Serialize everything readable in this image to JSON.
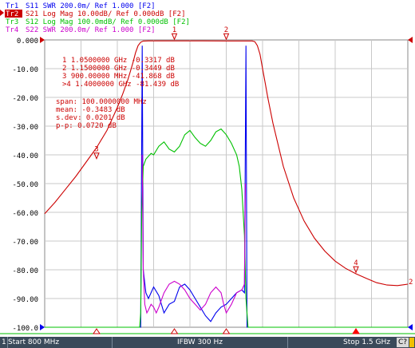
{
  "header_lines": [
    {
      "id": "Tr1",
      "trace": "Tr1",
      "text": "S11  SWR 200.0m/ Ref 1.000 [F2]",
      "color": "#0000ee",
      "active": false
    },
    {
      "id": "Tr2",
      "trace": "Tr2",
      "text": "S21  Log Mag 10.00dB/ Ref 0.000dB [F2]",
      "color": "#cc0000",
      "active": true
    },
    {
      "id": "Tr3",
      "trace": "Tr3",
      "text": "S12  Log Mag 100.0mdB/ Ref 0.000dB [F2]",
      "color": "#00c000",
      "active": false
    },
    {
      "id": "Tr4",
      "trace": "Tr4",
      "text": "S22  SWR 200.0m/ Ref 1.000 [F2]",
      "color": "#cc00cc",
      "active": false
    }
  ],
  "marker_table": [
    "  1   1.0500000 GHz  -0.3317 dB",
    "  2   1.1500000 GHz  -0.3449 dB",
    "  3   900.00000 MHz  -41.868 dB",
    " >4   1.4000000 GHz  -81.439 dB"
  ],
  "stats": [
    "    span:  100.0000000 MHz",
    "    mean:  -0.3483 dB",
    "  s.dev:   0.0201 dB",
    "    p-p:   0.0720 dB"
  ],
  "status": {
    "channel_number": "1",
    "start": "Start 800 MHz",
    "ifbw": "IFBW 300 Hz",
    "stop": "Stop 1.5 GHz",
    "channel": "C?"
  },
  "colors": {
    "s21": "#cc0000",
    "s11": "#0000ee",
    "s12": "#00c000",
    "s22": "#cc00cc",
    "grid": "#c8c8c8",
    "status_bg": "#3a4a5a"
  },
  "chart_data": {
    "type": "line",
    "x_unit": "MHz",
    "xlim": [
      800,
      1500
    ],
    "y_unit": "dB",
    "ylim": [
      -100,
      0
    ],
    "y_ticks": [
      "0.000",
      "-10.00",
      "-20.00",
      "-30.00",
      "-40.00",
      "-50.00",
      "-60.00",
      "-70.00",
      "-80.00",
      "-90.00",
      "-100.0"
    ],
    "x_divisions": 10,
    "grid": true,
    "series": [
      {
        "name": "S21",
        "color": "#cc0000",
        "x": [
          800,
          820,
          840,
          860,
          880,
          900,
          920,
          930,
          940,
          950,
          960,
          965,
          970,
          975,
          980,
          985,
          990,
          995,
          1000,
          1050,
          1100,
          1150,
          1200,
          1205,
          1210,
          1215,
          1220,
          1225,
          1230,
          1240,
          1260,
          1280,
          1300,
          1320,
          1340,
          1360,
          1380,
          1400,
          1420,
          1440,
          1460,
          1480,
          1500
        ],
        "values": [
          -60.5,
          -56.5,
          -52,
          -47.5,
          -42.5,
          -37.5,
          -31.5,
          -27.5,
          -23.5,
          -19,
          -14,
          -11,
          -8,
          -4.5,
          -2,
          -0.8,
          -0.4,
          -0.35,
          -0.34,
          -0.33,
          -0.34,
          -0.35,
          -0.36,
          -0.6,
          -2,
          -5,
          -10,
          -15,
          -20,
          -29,
          -44,
          -55,
          -63,
          -69,
          -73.5,
          -77,
          -79.5,
          -81.4,
          -83,
          -84.5,
          -85.3,
          -85.5,
          -85
        ]
      },
      {
        "name": "S11",
        "color": "#0000ee",
        "x": [
          800,
          985,
          988,
          990,
          995,
          1000,
          1010,
          1020,
          1030,
          1040,
          1050,
          1060,
          1070,
          1080,
          1090,
          1100,
          1110,
          1120,
          1130,
          1140,
          1150,
          1160,
          1170,
          1180,
          1185,
          1188,
          1190,
          1500
        ],
        "values": [
          -100,
          -100,
          -2,
          -80,
          -88,
          -90,
          -86,
          -89,
          -95,
          -92,
          -91,
          -86,
          -85,
          -87,
          -90,
          -93,
          -96,
          -98,
          -95,
          -93,
          -92,
          -90,
          -88,
          -87,
          -88,
          -2,
          -100,
          -100
        ]
      },
      {
        "name": "S12",
        "color": "#00c000",
        "x": [
          800,
          983,
          985,
          987,
          990,
          995,
          1000,
          1005,
          1010,
          1020,
          1030,
          1040,
          1050,
          1060,
          1070,
          1080,
          1090,
          1100,
          1110,
          1120,
          1130,
          1140,
          1150,
          1160,
          1170,
          1175,
          1180,
          1185,
          1188,
          1190,
          1192,
          1500
        ],
        "values": [
          -100,
          -100,
          -95,
          -60,
          -44,
          -41.5,
          -40.5,
          -39.5,
          -40,
          -37,
          -35.5,
          -38,
          -39,
          -37,
          -33,
          -31.5,
          -34,
          -36,
          -37,
          -35,
          -32,
          -31,
          -33,
          -36,
          -40,
          -44,
          -52,
          -68,
          -90,
          -95,
          -100,
          -100
        ]
      },
      {
        "name": "S22",
        "color": "#cc00cc",
        "x": [
          988,
          990,
          993,
          997,
          1000,
          1005,
          1010,
          1015,
          1020,
          1030,
          1040,
          1050,
          1060,
          1070,
          1080,
          1090,
          1100,
          1110,
          1120,
          1130,
          1140,
          1145,
          1150,
          1160,
          1170,
          1180,
          1185,
          1187
        ],
        "values": [
          -40,
          -80,
          -92,
          -95,
          -94,
          -92,
          -93,
          -95,
          -93,
          -88,
          -85,
          -84,
          -85,
          -87,
          -90,
          -92,
          -94,
          -92,
          -88,
          -86,
          -88,
          -92,
          -95,
          -92,
          -88,
          -87,
          -85,
          -50
        ]
      }
    ],
    "markers": [
      {
        "label": "1",
        "x": 1050,
        "y": -0.3317,
        "color": "#cc0000"
      },
      {
        "label": "2",
        "x": 1150,
        "y": -0.3449,
        "color": "#cc0000"
      },
      {
        "label": "3",
        "x": 900,
        "y": -41.868,
        "color": "#cc0000"
      },
      {
        "label": "4",
        "x": 1400,
        "y": -81.439,
        "color": "#cc0000"
      }
    ]
  }
}
